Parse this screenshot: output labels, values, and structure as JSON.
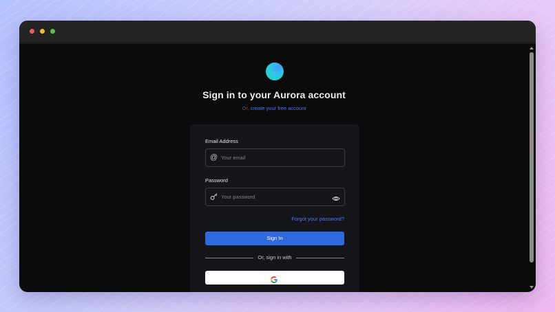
{
  "window": {
    "traffic_lights": [
      "close",
      "minimize",
      "zoom"
    ]
  },
  "auth": {
    "logo_icon": "gradient-circle-logo",
    "title": "Sign in to your Aurora account",
    "subtitle_prefix": "Or,",
    "create_account_link": "create your free account"
  },
  "form": {
    "email_label": "Email Address",
    "email_placeholder": "Your email",
    "email_icon": "at-sign-icon",
    "password_label": "Password",
    "password_placeholder": "Your password",
    "password_icon": "key-icon",
    "visibility_icon": "eye-icon",
    "forgot_link": "Forgot your password?",
    "signin_label": "Sign In",
    "divider_text": "Or, sign in with",
    "google_icon": "google-icon"
  },
  "colors": {
    "accent": "#3068e0",
    "link": "#4a78ff",
    "card": "#15161a",
    "window_bg": "#0b0b0b"
  }
}
